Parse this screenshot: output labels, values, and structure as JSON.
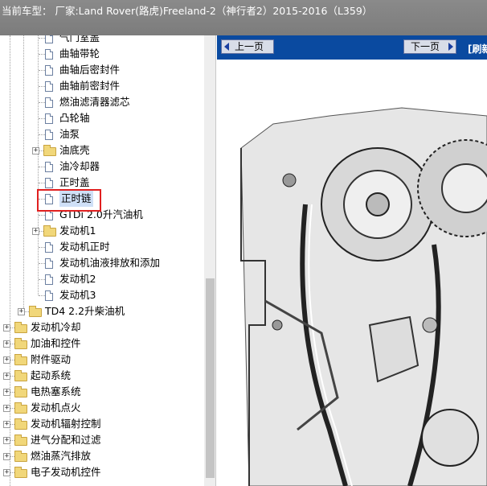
{
  "header": {
    "vehicle_label": "当前车型： 厂家:Land Rover(路虎)Freeland-2（神行者2）2015-2016（L359）"
  },
  "tree": {
    "items": [
      {
        "label": "气门室盖",
        "type": "doc"
      },
      {
        "label": "曲轴带轮",
        "type": "doc"
      },
      {
        "label": "曲轴后密封件",
        "type": "doc"
      },
      {
        "label": "曲轴前密封件",
        "type": "doc"
      },
      {
        "label": "燃油滤清器滤芯",
        "type": "doc"
      },
      {
        "label": "凸轮轴",
        "type": "doc"
      },
      {
        "label": "油泵",
        "type": "doc"
      },
      {
        "label": "油底壳",
        "type": "folder",
        "expander": "+"
      },
      {
        "label": "油冷却器",
        "type": "doc"
      },
      {
        "label": "正时盖",
        "type": "doc"
      },
      {
        "label": "正时链",
        "type": "doc",
        "selected": true
      },
      {
        "label": "GTDi 2.0升汽油机",
        "type": "doc"
      },
      {
        "label": "发动机1",
        "type": "folder",
        "expander": "+"
      },
      {
        "label": "发动机正时",
        "type": "doc"
      },
      {
        "label": "发动机油液排放和添加",
        "type": "doc"
      },
      {
        "label": "发动机2",
        "type": "doc"
      },
      {
        "label": "发动机3",
        "type": "doc"
      },
      {
        "label": "TD4 2.2升柴油机",
        "type": "folder",
        "expander": "+"
      },
      {
        "label": "发动机冷却",
        "type": "folder",
        "expander": "+"
      },
      {
        "label": "加油和控件",
        "type": "folder",
        "expander": "+"
      },
      {
        "label": "附件驱动",
        "type": "folder",
        "expander": "+"
      },
      {
        "label": "起动系统",
        "type": "folder",
        "expander": "+"
      },
      {
        "label": "电热塞系统",
        "type": "folder",
        "expander": "+"
      },
      {
        "label": "发动机点火",
        "type": "folder",
        "expander": "+"
      },
      {
        "label": "发动机辐射控制",
        "type": "folder",
        "expander": "+"
      },
      {
        "label": "进气分配和过滤",
        "type": "folder",
        "expander": "+"
      },
      {
        "label": "燃油蒸汽排放",
        "type": "folder",
        "expander": "+"
      },
      {
        "label": "电子发动机控件",
        "type": "folder",
        "expander": "+"
      }
    ]
  },
  "viewer": {
    "prev_label": "上一页",
    "next_label": "下一页",
    "refresh_label": "[刷新"
  },
  "colors": {
    "nav_bar": "#0a4aa0",
    "header_bar": "#808080",
    "highlight": "#e02020"
  }
}
